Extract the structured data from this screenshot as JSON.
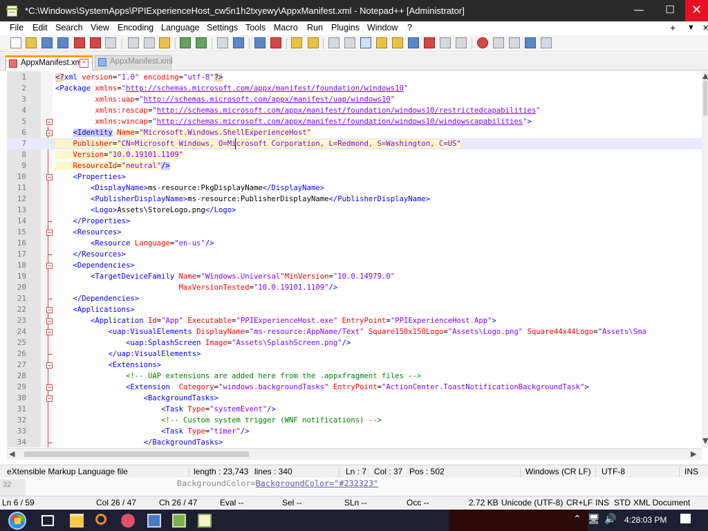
{
  "window": {
    "title": "*C:\\Windows\\SystemApps\\PPIExperienceHost_cw5n1h2txyewy\\AppxManifest.xml - Notepad++ [Administrator]",
    "minimize_glyph": "—",
    "maximize_glyph": "☐",
    "close_glyph": "✕"
  },
  "menu": {
    "items": [
      "File",
      "Edit",
      "Search",
      "View",
      "Encoding",
      "Language",
      "Settings",
      "Tools",
      "Macro",
      "Run",
      "Plugins",
      "Window",
      "?"
    ],
    "right_items": [
      "+",
      "▼",
      "✕"
    ]
  },
  "toolbar": {
    "icons": [
      "new-file-icon",
      "open-file-icon",
      "save-icon",
      "save-all-icon",
      "close-icon",
      "close-all-icon",
      "print-icon",
      "cut-icon",
      "copy-icon",
      "paste-icon",
      "undo-icon",
      "redo-icon",
      "find-icon",
      "replace-icon",
      "zoom-in-icon",
      "zoom-out-icon",
      "sync-vertical-icon",
      "sync-horizontal-icon",
      "word-wrap-icon",
      "show-all-characters-icon",
      "indent-guide-icon",
      "language-icon",
      "document-map-icon",
      "function-list-icon",
      "folder-workspace-icon",
      "monitoring-icon",
      "record-macro-icon",
      "stop-recording-icon",
      "playback-icon",
      "run-macro-icon",
      "save-macro-icon"
    ]
  },
  "tabs": [
    {
      "label": "AppxManifest.xml",
      "active": true,
      "close_glyph": "×"
    },
    {
      "label": "AppxManifest.xml",
      "active": false
    }
  ],
  "editor": {
    "line_numbers": [
      "1",
      "2",
      "3",
      "4",
      "5",
      "6",
      "7",
      "8",
      "9",
      "10",
      "11",
      "12",
      "13",
      "14",
      "15",
      "16",
      "17",
      "18",
      "19",
      "20",
      "21",
      "22",
      "23",
      "24",
      "25",
      "26",
      "27",
      "28",
      "29",
      "30",
      "31",
      "32",
      "33",
      "34"
    ],
    "lines": [
      "<?xml version=\"1.0\" encoding=\"utf-8\"?>",
      "<Package xmlns=\"http://schemas.microsoft.com/appx/manifest/foundation/windows10\"",
      "         xmlns:uap=\"http://schemas.microsoft.com/appx/manifest/uap/windows10\"",
      "         xmlns:rescap=\"http://schemas.microsoft.com/appx/manifest/foundation/windows10/restrictedcapabilities\"",
      "         xmlns:wincap=\"http://schemas.microsoft.com/appx/manifest/foundation/windows10/windowscapabilities\">",
      "    <Identity Name=\"Microsoft.Windows.ShellExperienceHost\"",
      "    Publisher=\"CN=Microsoft Windows, O=Microsoft Corporation, L=Redmond, S=Washington, C=US\"",
      "    Version=\"10.0.19101.1109\"",
      "    ResourceId=\"neutral\"/>",
      "    <Properties>",
      "        <DisplayName>ms-resource:PkgDisplayName</DisplayName>",
      "        <PublisherDisplayName>ms-resource:PublisherDisplayName</PublisherDisplayName>",
      "        <Logo>Assets\\StoreLogo.png</Logo>",
      "    </Properties>",
      "    <Resources>",
      "        <Resource Language=\"en-us\"/>",
      "    </Resources>",
      "    <Dependencies>",
      "        <TargetDeviceFamily Name=\"Windows.Universal\"MinVersion=\"10.0.14979.0\"",
      "                            MaxVersionTested=\"10.0.19101.1109\"/>",
      "    </Dependencies>",
      "    <Applications>",
      "        <Application Id=\"App\" Executable=\"PPIExperienceHost.exe\" EntryPoint=\"PPIExperienceHost.App\">",
      "            <uap:VisualElements DisplayName=\"ms-resource:AppName/Text\" Square150x150Logo=\"Assets\\Logo.png\" Square44x44Logo=\"Assets\\Sma",
      "                <uap:SplashScreen Image=\"Assets\\SplashScreen.png\"/>",
      "            </uap:VisualElements>",
      "            <Extensions>",
      "                <!-- UAP extensions are added here from the .appxfragment files -->",
      "                <Extension  Category=\"windows.backgroundTasks\" EntryPoint=\"ActionCenter.ToastNotificationBackgroundTask\">",
      "                    <BackgroundTasks>",
      "                        <Task Type=\"systemEvent\"/>",
      "                        <!-- Custom system trigger (WNF notifications) -->",
      "                        <Task Type=\"timer\"/>",
      "                    </BackgroundTasks>"
    ]
  },
  "status": {
    "file_type": "eXtensible Markup Language file",
    "length": "length : 23,743",
    "lines": "lines : 340",
    "ln": "Ln : 7",
    "col": "Col : 37",
    "pos": "Pos : 502",
    "eol": "Windows (CR LF)",
    "encoding": "UTF-8",
    "mode": "INS"
  },
  "background_window": {
    "visible_line": "BackgroundColor=\"#232323\"",
    "line_marker": "32",
    "status": {
      "ln": "Ln 6 / 59",
      "col": "Col 26 / 47",
      "ch": "Ch 26 / 47",
      "eval": "Eval  --",
      "sel": "Sel  --",
      "sln": "SLn  --",
      "occ": "Occ  --",
      "size": "2.72 KB",
      "encoding": "Unicode (UTF-8)",
      "eol": "CR+LF",
      "ins": "INS",
      "std": "STD",
      "doc": "XML Document"
    }
  },
  "taskbar": {
    "time": "4:28:03 PM",
    "icons": [
      "start-orb-icon",
      "task-view-icon",
      "file-explorer-icon",
      "search-icon",
      "colorful-app-icon",
      "monitor-app-icon",
      "green-app-icon",
      "notepad-plus-plus-icon"
    ],
    "tray": [
      "show-hidden-icons-icon",
      "network-icon",
      "volume-icon",
      "action-center-icon"
    ]
  }
}
